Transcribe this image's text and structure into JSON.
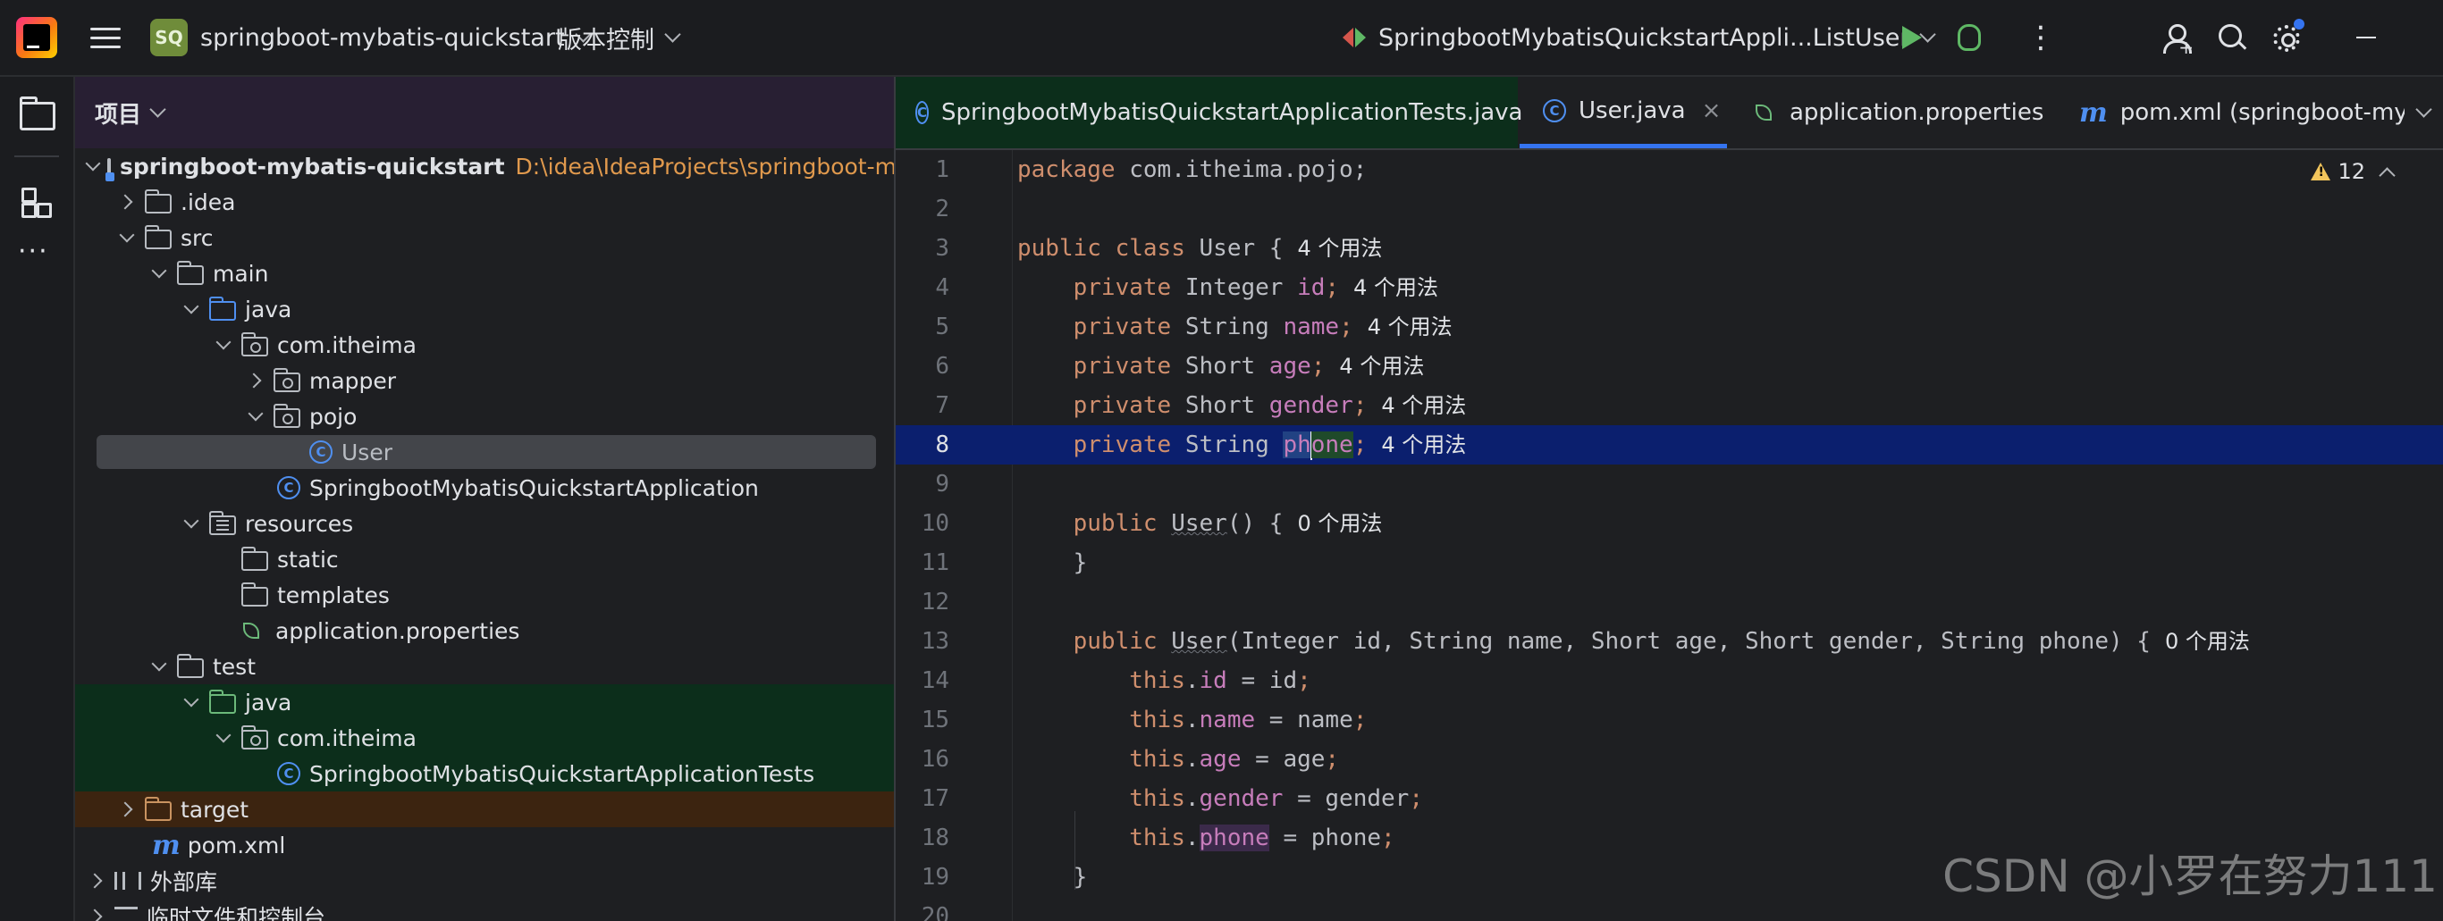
{
  "titlebar": {
    "project_badge": "SQ",
    "project_name": "springboot-mybatis-quickstart",
    "vcs_label": "版本控制",
    "run_config": "SpringbootMybatisQuickstartAppli...ListUser"
  },
  "project_panel": {
    "title": "项目",
    "tree": [
      {
        "label": "springboot-mybatis-quickstart",
        "path": "D:\\idea\\IdeaProjects\\springboot-myb"
      },
      {
        "label": ".idea"
      },
      {
        "label": "src"
      },
      {
        "label": "main"
      },
      {
        "label": "java"
      },
      {
        "label": "com.itheima"
      },
      {
        "label": "mapper"
      },
      {
        "label": "pojo"
      },
      {
        "label": "User"
      },
      {
        "label": "SpringbootMybatisQuickstartApplication"
      },
      {
        "label": "resources"
      },
      {
        "label": "static"
      },
      {
        "label": "templates"
      },
      {
        "label": "application.properties"
      },
      {
        "label": "test"
      },
      {
        "label": "java"
      },
      {
        "label": "com.itheima"
      },
      {
        "label": "SpringbootMybatisQuickstartApplicationTests"
      },
      {
        "label": "target"
      },
      {
        "label": "pom.xml"
      },
      {
        "label": "外部库"
      },
      {
        "label": "临时文件和控制台"
      }
    ]
  },
  "tabs": [
    {
      "label": "SpringbootMybatisQuickstartApplicationTests.java"
    },
    {
      "label": "User.java",
      "close": "×"
    },
    {
      "label": "application.properties"
    },
    {
      "label": "pom.xml (springboot-myb"
    }
  ],
  "editor": {
    "warnings": "12",
    "usage_hints": {
      "u4": "4 个用法",
      "u0": "0 个用法"
    },
    "line_numbers": [
      "1",
      "2",
      "3",
      "4",
      "5",
      "6",
      "7",
      "8",
      "9",
      "10",
      "11",
      "12",
      "13",
      "14",
      "15",
      "16",
      "17",
      "18",
      "19",
      "20"
    ],
    "code": {
      "l1": "package com.itheima.pojo;",
      "kw_package": "package",
      "pkg": " com.itheima.pojo;",
      "public": "public",
      "class": "class",
      "private": "private",
      "this": "this",
      "User": "User",
      "Integer": "Integer",
      "String": "String",
      "Short": "Short",
      "id": "id",
      "name": "name",
      "age": "age",
      "gender": "gender",
      "phone_a": "ph",
      "phone_b": "one",
      "phone": "phone",
      "ctor_params": "(Integer id, String name, Short age, Short gender, String phone) {"
    }
  },
  "watermark": "CSDN @小罗在努力111"
}
